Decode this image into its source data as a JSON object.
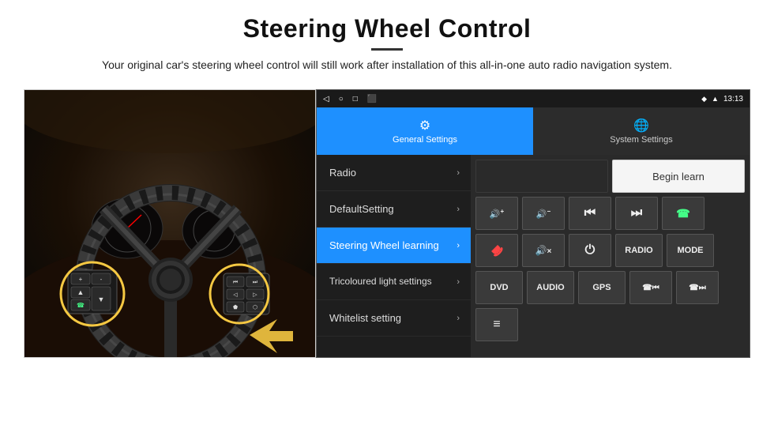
{
  "page": {
    "title": "Steering Wheel Control",
    "divider": true,
    "subtitle": "Your original car's steering wheel control will still work after installation of this all-in-one auto radio navigation system."
  },
  "status_bar": {
    "time": "13:13",
    "icons_left": [
      "◁",
      "○",
      "□",
      "⬛"
    ],
    "icons_right": [
      "◆",
      "▲",
      "13:13"
    ]
  },
  "tabs": [
    {
      "id": "general",
      "label": "General Settings",
      "active": true
    },
    {
      "id": "system",
      "label": "System Settings",
      "active": false
    }
  ],
  "menu": {
    "items": [
      {
        "id": "radio",
        "label": "Radio",
        "active": false
      },
      {
        "id": "default-setting",
        "label": "DefaultSetting",
        "active": false
      },
      {
        "id": "steering-wheel",
        "label": "Steering Wheel learning",
        "active": true
      },
      {
        "id": "tricoloured",
        "label": "Tricoloured light settings",
        "active": false
      },
      {
        "id": "whitelist",
        "label": "Whitelist setting",
        "active": false
      }
    ]
  },
  "controls": {
    "rows": [
      {
        "left_empty": true,
        "begin_learn": "Begin learn"
      },
      {
        "buttons": [
          "🔊+",
          "🔊−",
          "⏮",
          "⏭",
          "☏"
        ]
      },
      {
        "buttons": [
          "↩",
          "🔇×",
          "⏻",
          "RADIO",
          "MODE"
        ]
      },
      {
        "buttons": [
          "DVD",
          "AUDIO",
          "GPS",
          "☏⏮",
          "☏⏭"
        ]
      }
    ],
    "bottom_icon": "☰",
    "row1_begin_learn": "Begin learn",
    "vol_up": "🔊+",
    "vol_down": "🔊−",
    "prev": "⏮",
    "next": "⏭",
    "phone": "☏",
    "hangup": "↩",
    "mute_x": "🔇×",
    "power": "⏻",
    "radio_label": "RADIO",
    "mode_label": "MODE",
    "dvd_label": "DVD",
    "audio_label": "AUDIO",
    "gps_label": "GPS",
    "tel_prev": "☏⏮",
    "tel_next": "☏⏭",
    "list_icon": "≡"
  }
}
